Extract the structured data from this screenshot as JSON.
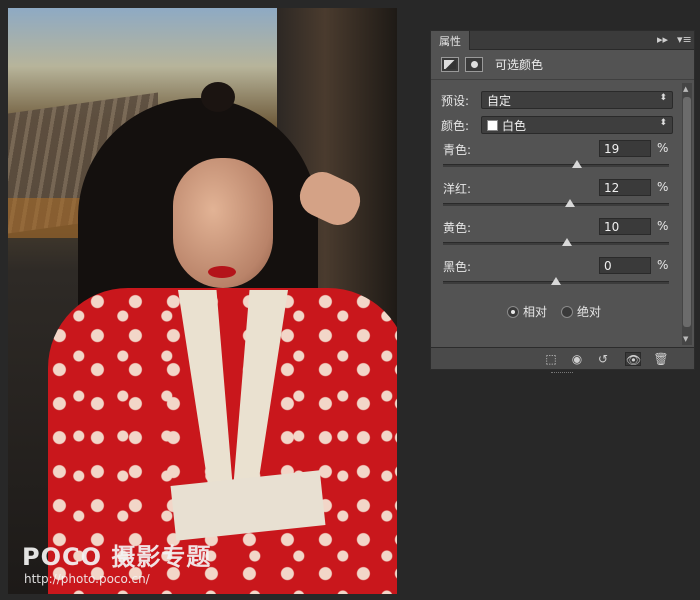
{
  "panel": {
    "tab": "属性",
    "tab_controls": {
      "collapse": "▸▸",
      "menu": "▾≡"
    },
    "title": "可选颜色",
    "preset": {
      "label": "预设:",
      "value": "自定"
    },
    "colors": {
      "label": "颜色:",
      "value": "白色"
    },
    "sliders": [
      {
        "label": "青色:",
        "value": "19",
        "unit": "%",
        "thumb_pct": 59.5
      },
      {
        "label": "洋红:",
        "value": "12",
        "unit": "%",
        "thumb_pct": 56
      },
      {
        "label": "黄色:",
        "value": "10",
        "unit": "%",
        "thumb_pct": 55
      },
      {
        "label": "黑色:",
        "value": "0",
        "unit": "%",
        "thumb_pct": 50
      }
    ],
    "method": {
      "relative": "相对",
      "absolute": "绝对",
      "selected": "relative"
    }
  },
  "watermark": {
    "brand": "POCO 摄影专题",
    "url": "http://photo.poco.cn/"
  }
}
